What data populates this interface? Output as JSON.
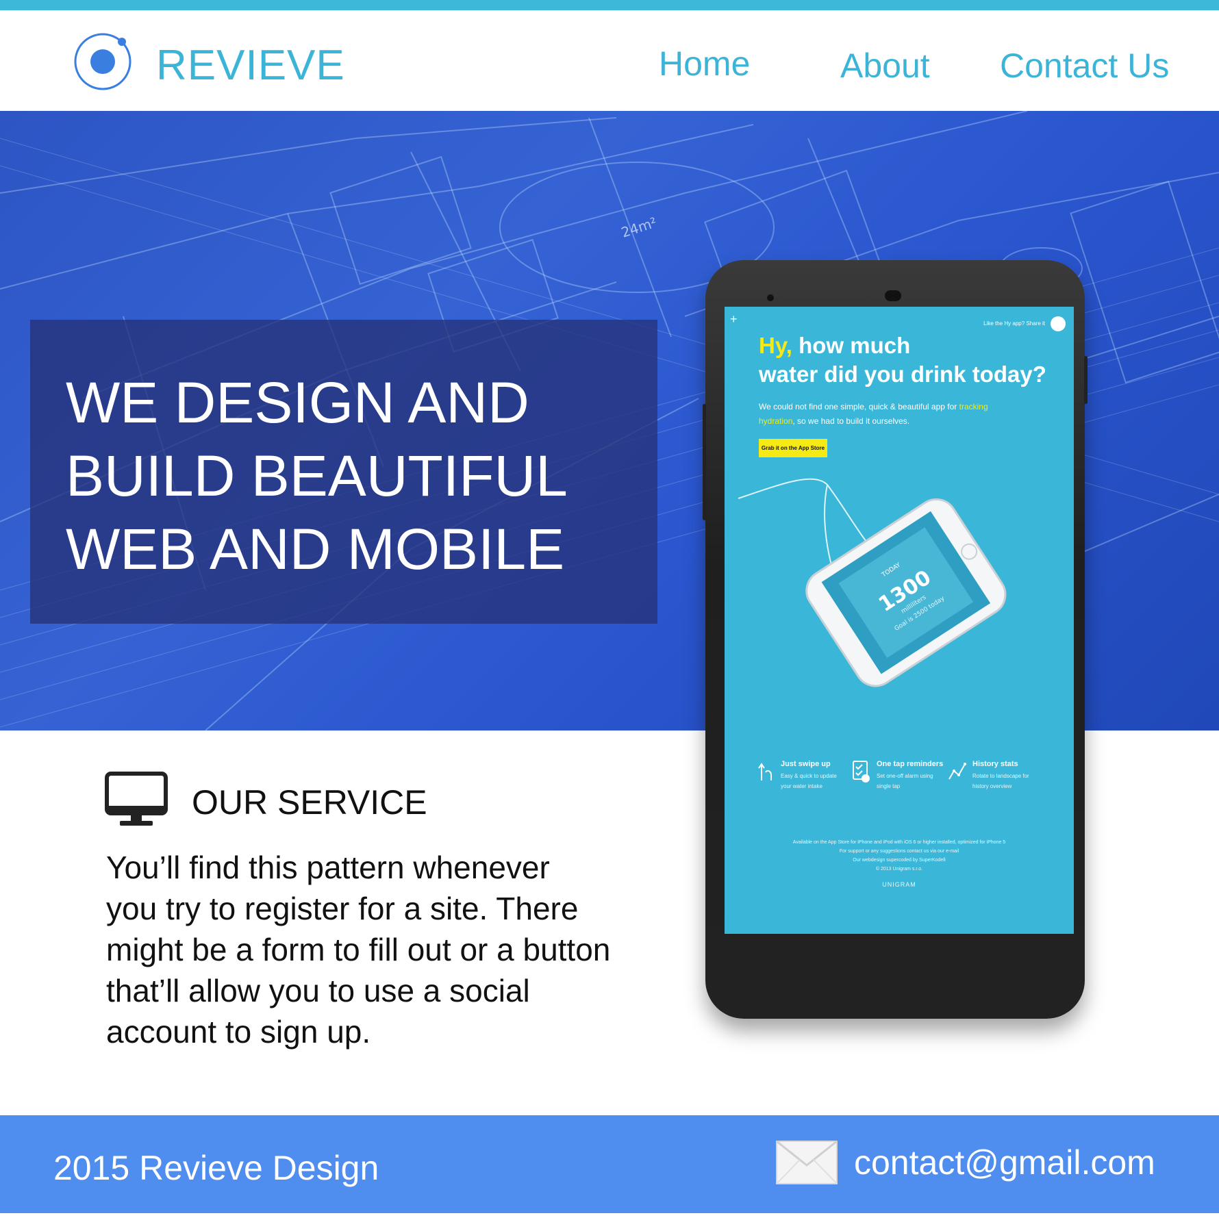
{
  "header": {
    "brand": "REVIEVE",
    "nav": [
      "Home",
      "About",
      "Contact Us"
    ]
  },
  "hero": {
    "title_lines": [
      "WE DESIGN AND",
      "BUILD BEAUTIFUL",
      "WEB AND MOBILE"
    ]
  },
  "service": {
    "title": "OUR SERVICE",
    "text_lines": [
      "You’ll find this pattern whenever",
      "you try to register for a site. There",
      "might be a form to fill out or a button",
      "that’ll allow you to use a social",
      "account to sign up."
    ]
  },
  "phone_screen": {
    "share_text": "Like the Hy app? Share it",
    "headline_hy": "Hy,",
    "headline_rest": " how much",
    "headline_line2": "water did you drink today?",
    "sub_a": "We could not find one simple, quick & beautiful app for ",
    "sub_b": "tracking hydration",
    "sub_c": ", so we had to build it ourselves.",
    "button": "Grab it on the App Store",
    "inner_phone": {
      "label_today": "TODAY",
      "value": "1300",
      "unit": "milliliters",
      "goal": "Goal is 2500 today"
    },
    "features": [
      {
        "title": "Just swipe up",
        "desc1": "Easy & quick to update",
        "desc2": "your water intake"
      },
      {
        "title": "One tap reminders",
        "desc1": "Set one-off alarm using",
        "desc2": "single tap"
      },
      {
        "title": "History stats",
        "desc1": "Rotate to landscape for",
        "desc2": "history overview"
      }
    ],
    "footer_lines": [
      "Available on the App Store for iPhone and iPod with iOS 6 or higher installed, optimized for iPhone 5",
      "For support or any suggestions contact us via our e-mail",
      "Our webdesign supercoded by SuperKodefi",
      "© 2013 Unigram s.r.o."
    ],
    "logo": "UNIGRAM"
  },
  "footer": {
    "copyright": "2015 Revieve Design",
    "email": "contact@gmail.com"
  },
  "colors": {
    "accent": "#3cb4d7",
    "footer_bg": "#4f8def",
    "hero_bg": "#2d55c4",
    "app_bg": "#3ab7d8",
    "app_highlight": "#f5ea14"
  },
  "icons": [
    "logo-icon",
    "monitor-icon",
    "envelope-icon",
    "share-icon",
    "swipe-icon",
    "reminder-icon",
    "chart-icon"
  ]
}
